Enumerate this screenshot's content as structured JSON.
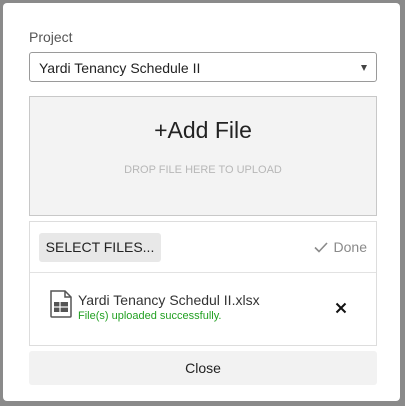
{
  "project": {
    "label": "Project",
    "selected": "Yardi Tenancy Schedule II"
  },
  "dropzone": {
    "title": "+Add File",
    "hint": "DROP FILE HERE TO UPLOAD"
  },
  "files": {
    "select_label": "SELECT FILES...",
    "done_label": "Done",
    "items": [
      {
        "name": "Yardi Tenancy Schedul II.xlsx",
        "status": "File(s) uploaded successfully.",
        "icon": "spreadsheet-file-icon"
      }
    ]
  },
  "footer": {
    "close_label": "Close"
  },
  "colors": {
    "success": "#22a022",
    "muted": "#8a8a8a"
  }
}
